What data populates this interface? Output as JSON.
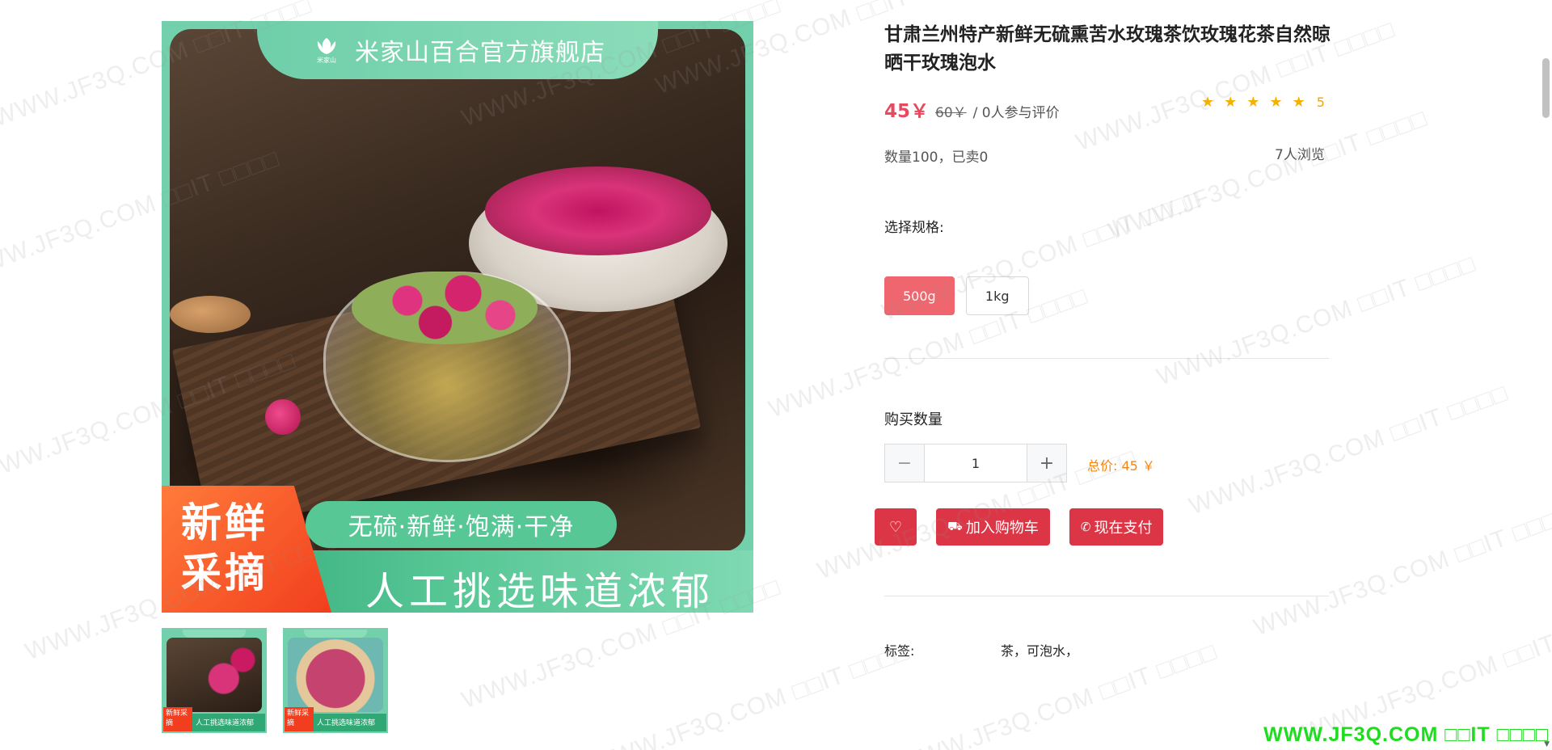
{
  "product": {
    "title": "甘肃兰州特产新鲜无硫熏苦水玫瑰茶饮玫瑰花茶自然晾晒干玫瑰泡水",
    "price": "45￥",
    "old_price": "60￥",
    "reviews_text": "/ 0人参与评价",
    "rating_value": "5",
    "stock_text": "数量100，已卖0",
    "views_text": "7人浏览"
  },
  "image": {
    "store_name": "米家山百合官方旗舰店",
    "logo_sub": "米家山",
    "badge_line1": "新鲜",
    "badge_line2": "采摘",
    "pill_text": "无硫·新鲜·饱满·干净",
    "slogan": "人工挑选味道浓郁"
  },
  "thumbnails": [
    {
      "badge": "新鲜采摘",
      "text": "人工挑选味道浓郁"
    },
    {
      "badge": "新鲜采摘",
      "text": "人工挑选味道浓郁"
    }
  ],
  "spec": {
    "label": "选择规格:",
    "options": [
      "500g",
      "1kg"
    ],
    "selected": "500g"
  },
  "quantity": {
    "label": "购买数量",
    "value": "1",
    "minus": "−",
    "plus": "+"
  },
  "total": {
    "text": "总价: 45 ￥"
  },
  "actions": {
    "favorite_icon": "♡",
    "cart_icon": "⛟",
    "cart_label": "加入购物车",
    "pay_icon": "✆",
    "pay_label": "现在支付"
  },
  "tags": {
    "label": "标签:",
    "value": "茶，可泡水，"
  },
  "watermark": {
    "text": "WWW.JF3Q.COM □□IT □□□□",
    "site_mark": "WWW.JF3Q.COM □□IT □□□□"
  },
  "colors": {
    "accent": "#dc3545",
    "price": "#e8495e",
    "star": "#f5b100",
    "selected_spec": "#f0666e",
    "total": "#f5860f",
    "site_mark": "#1fdc1f"
  },
  "icons": {
    "star": "★",
    "favorite": "heart-icon",
    "cart": "cart-icon",
    "pay": "pay-icon"
  }
}
